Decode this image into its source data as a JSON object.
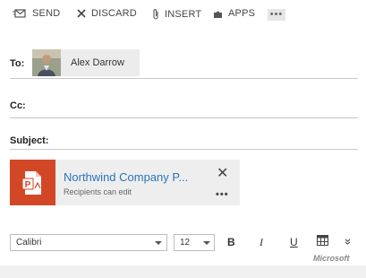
{
  "toolbar": {
    "send_label": "SEND",
    "discard_label": "DISCARD",
    "insert_label": "INSERT",
    "apps_label": "APPS",
    "more_label": "•••"
  },
  "fields": {
    "to_label": "To:",
    "cc_label": "Cc:",
    "subject_label": "Subject:",
    "to_recipient": "Alex Darrow"
  },
  "attachment": {
    "title": "Northwind Company P...",
    "subtitle": "Recipients can edit",
    "close_label": "✕",
    "more_label": "•••",
    "icon": "powerpoint-file-icon",
    "color": "#d24726"
  },
  "format_bar": {
    "font_name": "Calibri",
    "font_size": "12",
    "bold_label": "B",
    "italic_label": "I",
    "underline_label": "U",
    "expand_label": "»"
  },
  "brand_text": "Microsoft",
  "colors": {
    "link": "#2b74b8",
    "accent": "#d24726"
  }
}
